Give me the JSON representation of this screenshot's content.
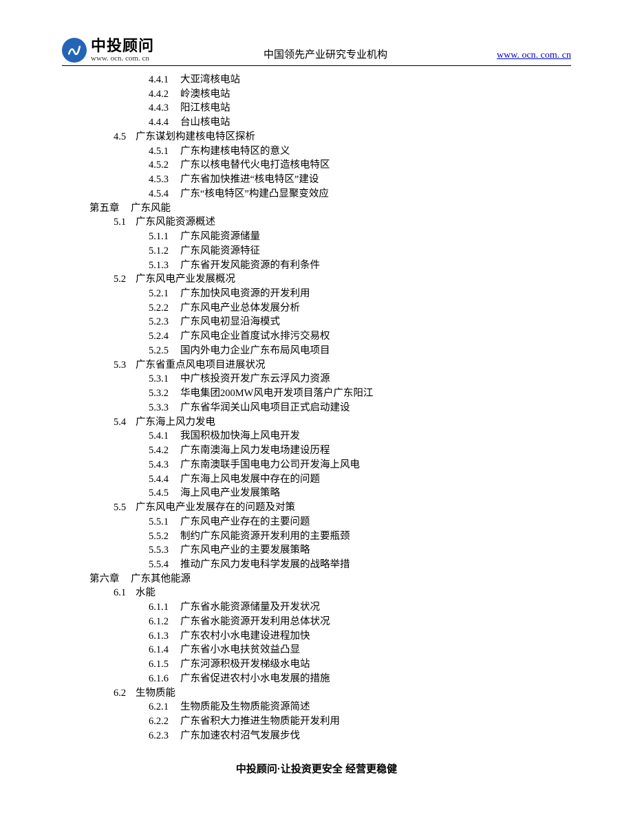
{
  "header": {
    "logo_main": "中投顾问",
    "logo_sub": "www. ocn. com. cn",
    "center": "中国领先产业研究专业机构",
    "right": "www. ocn. com. cn"
  },
  "toc": [
    {
      "level": "sub",
      "num": "4.4.1",
      "text": "大亚湾核电站"
    },
    {
      "level": "sub",
      "num": "4.4.2",
      "text": "岭澳核电站"
    },
    {
      "level": "sub",
      "num": "4.4.3",
      "text": "阳江核电站"
    },
    {
      "level": "sub",
      "num": "4.4.4",
      "text": "台山核电站"
    },
    {
      "level": "section",
      "num": "4.5",
      "text": "广东谋划构建核电特区探析"
    },
    {
      "level": "sub",
      "num": "4.5.1",
      "text": "广东构建核电特区的意义"
    },
    {
      "level": "sub",
      "num": "4.5.2",
      "text": "广东以核电替代火电打造核电特区"
    },
    {
      "level": "sub",
      "num": "4.5.3",
      "text": "广东省加快推进“核电特区”建设"
    },
    {
      "level": "sub",
      "num": "4.5.4",
      "text": "广东“核电特区”构建凸显聚变效应"
    },
    {
      "level": "chapter",
      "num": "第五章",
      "text": "广东风能"
    },
    {
      "level": "section",
      "num": "5.1",
      "text": "广东风能资源概述"
    },
    {
      "level": "sub",
      "num": "5.1.1",
      "text": "广东风能资源储量"
    },
    {
      "level": "sub",
      "num": "5.1.2",
      "text": "广东风能资源特征"
    },
    {
      "level": "sub",
      "num": "5.1.3",
      "text": "广东省开发风能资源的有利条件"
    },
    {
      "level": "section",
      "num": "5.2",
      "text": "广东风电产业发展概况"
    },
    {
      "level": "sub",
      "num": "5.2.1",
      "text": "广东加快风电资源的开发利用"
    },
    {
      "level": "sub",
      "num": "5.2.2",
      "text": "广东风电产业总体发展分析"
    },
    {
      "level": "sub",
      "num": "5.2.3",
      "text": "广东风电初显沿海模式"
    },
    {
      "level": "sub",
      "num": "5.2.4",
      "text": "广东风电企业首度试水排污交易权"
    },
    {
      "level": "sub",
      "num": "5.2.5",
      "text": "国内外电力企业广东布局风电项目"
    },
    {
      "level": "section",
      "num": "5.3",
      "text": "广东省重点风电项目进展状况"
    },
    {
      "level": "sub",
      "num": "5.3.1",
      "text": "中广核投资开发广东云浮风力资源"
    },
    {
      "level": "sub",
      "num": "5.3.2",
      "text": "华电集团200MW风电开发项目落户广东阳江"
    },
    {
      "level": "sub",
      "num": "5.3.3",
      "text": "广东省华润关山风电项目正式启动建设"
    },
    {
      "level": "section",
      "num": "5.4",
      "text": "广东海上风力发电"
    },
    {
      "level": "sub",
      "num": "5.4.1",
      "text": "我国积极加快海上风电开发"
    },
    {
      "level": "sub",
      "num": "5.4.2",
      "text": "广东南澳海上风力发电场建设历程"
    },
    {
      "level": "sub",
      "num": "5.4.3",
      "text": "广东南澳联手国电电力公司开发海上风电"
    },
    {
      "level": "sub",
      "num": "5.4.4",
      "text": "广东海上风电发展中存在的问题"
    },
    {
      "level": "sub",
      "num": "5.4.5",
      "text": "海上风电产业发展策略"
    },
    {
      "level": "section",
      "num": "5.5",
      "text": "广东风电产业发展存在的问题及对策"
    },
    {
      "level": "sub",
      "num": "5.5.1",
      "text": "广东风电产业存在的主要问题"
    },
    {
      "level": "sub",
      "num": "5.5.2",
      "text": "制约广东风能资源开发利用的主要瓶颈"
    },
    {
      "level": "sub",
      "num": "5.5.3",
      "text": "广东风电产业的主要发展策略"
    },
    {
      "level": "sub",
      "num": "5.5.4",
      "text": "推动广东风力发电科学发展的战略举措"
    },
    {
      "level": "chapter",
      "num": "第六章",
      "text": "广东其他能源"
    },
    {
      "level": "section",
      "num": "6.1",
      "text": "水能"
    },
    {
      "level": "sub",
      "num": "6.1.1",
      "text": "广东省水能资源储量及开发状况"
    },
    {
      "level": "sub",
      "num": "6.1.2",
      "text": "广东省水能资源开发利用总体状况"
    },
    {
      "level": "sub",
      "num": "6.1.3",
      "text": "广东农村小水电建设进程加快"
    },
    {
      "level": "sub",
      "num": "6.1.4",
      "text": "广东省小水电扶贫效益凸显"
    },
    {
      "level": "sub",
      "num": "6.1.5",
      "text": "广东河源积极开发梯级水电站"
    },
    {
      "level": "sub",
      "num": "6.1.6",
      "text": "广东省促进农村小水电发展的措施"
    },
    {
      "level": "section",
      "num": "6.2",
      "text": "生物质能"
    },
    {
      "level": "sub",
      "num": "6.2.1",
      "text": "生物质能及生物质能资源简述"
    },
    {
      "level": "sub",
      "num": "6.2.2",
      "text": "广东省积大力推进生物质能开发利用"
    },
    {
      "level": "sub",
      "num": "6.2.3",
      "text": "广东加速农村沼气发展步伐"
    }
  ],
  "footer": "中投顾问·让投资更安全  经营更稳健"
}
